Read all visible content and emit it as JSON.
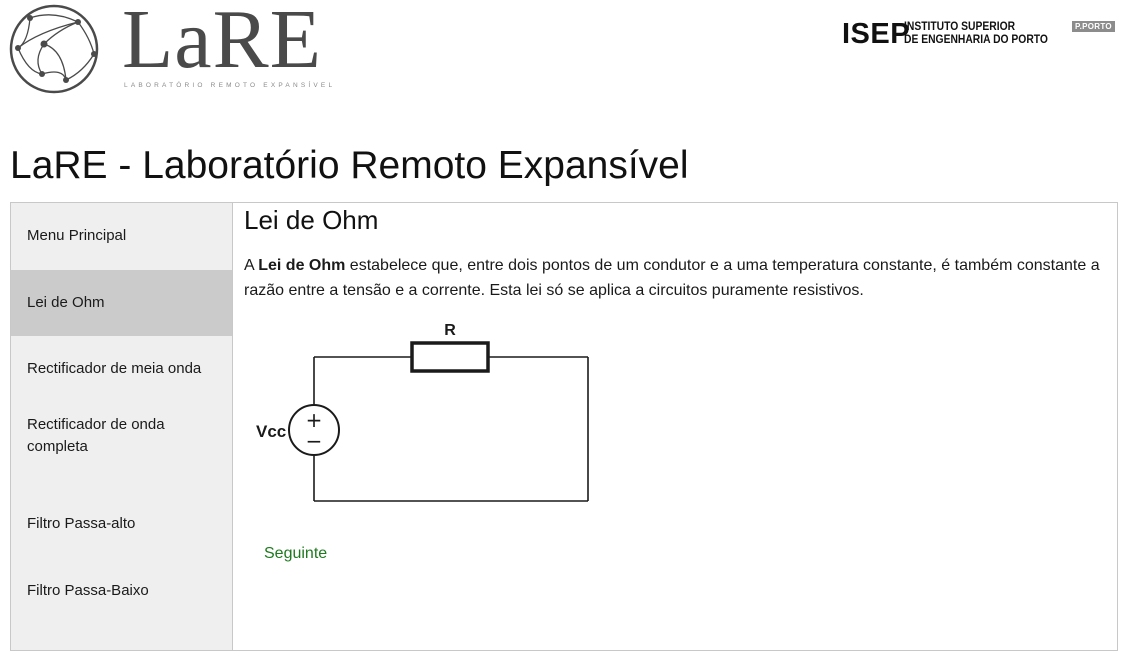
{
  "header": {
    "logo_word": "LaRE",
    "logo_subtitle": "LABORATÓRIO REMOTO EXPANSÍVEL",
    "institution_abbr": "ISEP",
    "institution_name_line1": "INSTITUTO SUPERIOR",
    "institution_name_line2": "DE ENGENHARIA DO PORTO",
    "badge": "P.PORTO"
  },
  "page_title": "LaRE - Laboratório Remoto Expansível",
  "sidebar": {
    "items": [
      {
        "label": "Menu Principal",
        "active": false
      },
      {
        "label": "Lei de Ohm",
        "active": true
      },
      {
        "label": "Rectificador de meia onda",
        "active": false
      },
      {
        "label": "Rectificador de onda completa",
        "active": false
      },
      {
        "label": "Filtro Passa-alto",
        "active": false
      },
      {
        "label": "Filtro Passa-Baixo",
        "active": false
      }
    ]
  },
  "content": {
    "heading": "Lei de Ohm",
    "paragraph_start": "A ",
    "paragraph_bold": "Lei de Ohm",
    "paragraph_rest": " estabelece que, entre dois pontos de um condutor e a uma temperatura constante, é também constante a razão entre a tensão e a corrente. Esta lei só se aplica a circuitos puramente resistivos.",
    "circuit": {
      "resistor_label": "R",
      "source_label": "Vcc",
      "plus_symbol": "+",
      "minus_symbol": "−"
    },
    "next_link": "Seguinte"
  },
  "colors": {
    "sidebar_bg": "#efefef",
    "sidebar_active_bg": "#cbcbcb",
    "link_green": "#1d7a1d",
    "border": "#c8c8c8"
  }
}
